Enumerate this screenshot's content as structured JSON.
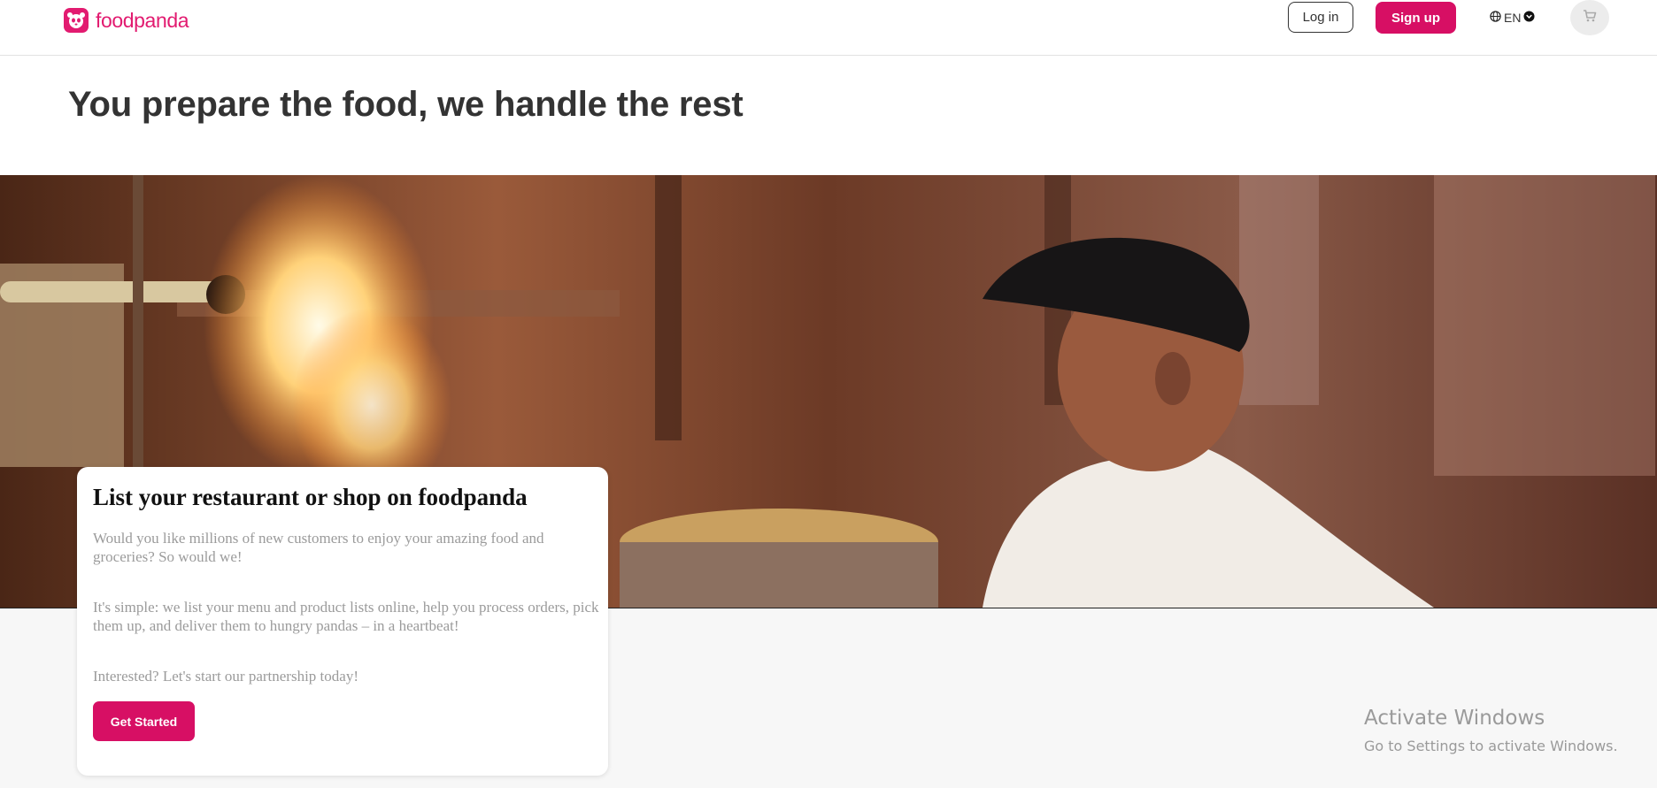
{
  "header": {
    "brand": "foodpanda",
    "login_label": "Log in",
    "signup_label": "Sign up",
    "language": "EN",
    "accent_color": "#d70f64"
  },
  "hero": {
    "headline": "You prepare the food, we handle the rest"
  },
  "card": {
    "title": "List your restaurant or shop on foodpanda",
    "paragraph_1": "Would you like millions of new customers to enjoy your amazing food and groceries? So would we!",
    "paragraph_2": "It's simple: we list your menu and product lists online, help you process orders, pick them up, and deliver them to hungry pandas – in a heartbeat!",
    "paragraph_3": "Interested? Let's start our partnership today!",
    "cta_label": "Get Started"
  },
  "watermark": {
    "title": "Activate Windows",
    "subtitle": "Go to Settings to activate Windows."
  }
}
